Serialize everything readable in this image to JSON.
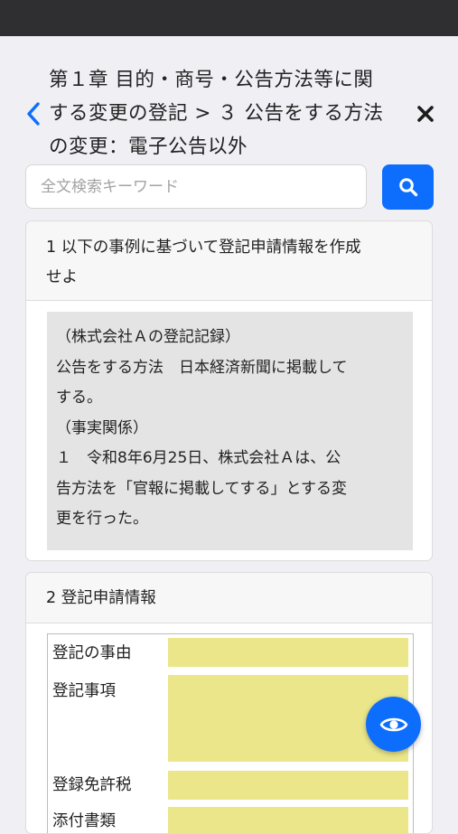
{
  "header": {
    "title_lines": [
      "第１章 目的・商号・公告方法等に関",
      "する変更の登記 > ３ 公告をする方法",
      "の変更：電子公告以外"
    ]
  },
  "search": {
    "placeholder": "全文検索キーワード",
    "value": ""
  },
  "section1": {
    "heading_lines": [
      "1 以下の事例に基づいて登記申請情報を作成",
      "せよ"
    ],
    "body_lines": [
      "（株式会社Ａの登記記録）",
      "公告をする方法　日本経済新聞に掲載して",
      "する。",
      "（事実関係）",
      "１　令和8年6月25日、株式会社Ａは、公",
      "告方法を「官報に掲載してする」とする変",
      "更を行った。"
    ]
  },
  "section2": {
    "heading": "2 登記申請情報",
    "rows": [
      "登記の事由",
      "登記事項",
      "登録免許税",
      "添付書類"
    ]
  },
  "icons": {
    "back": "chevron-left-icon",
    "close": "close-icon",
    "search": "search-icon",
    "toggle_answer": "eye-icon"
  },
  "colors": {
    "accent": "#0d6efd",
    "answer_fill": "#ebe68a",
    "facts_bg": "#e4e4e4",
    "status_bar": "#2f2f31"
  }
}
